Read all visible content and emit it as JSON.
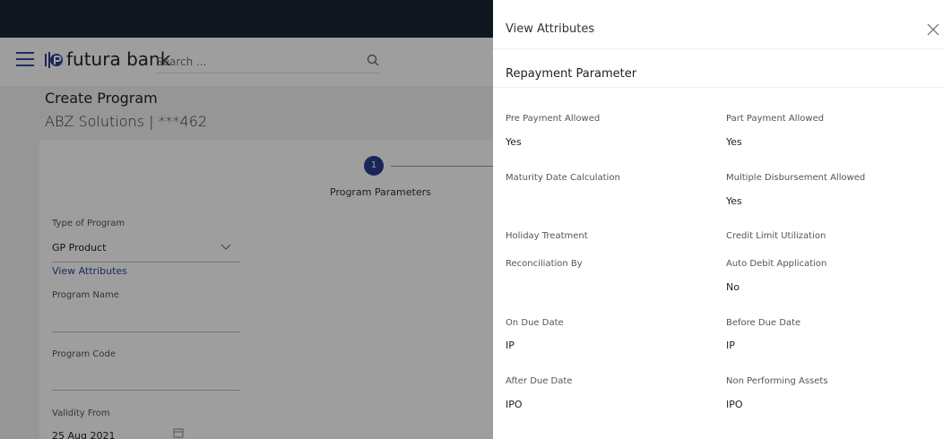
{
  "header": {
    "brand": "futura bank",
    "search_placeholder": "Search ..."
  },
  "page": {
    "title": "Create Program",
    "subtitle": "ABZ Solutions | ***462"
  },
  "stepper": {
    "step_number": "1",
    "step_label": "Program Parameters"
  },
  "form": {
    "type_label": "Type of Program",
    "type_value": "GP Product",
    "view_attributes_link": "View Attributes",
    "program_name_label": "Program Name",
    "program_code_label": "Program Code",
    "validity_from_label": "Validity From",
    "validity_from_value": "25 Aug 2021"
  },
  "drawer": {
    "title": "View Attributes",
    "section": "Repayment Parameter",
    "attributes": [
      {
        "label": "Pre Payment Allowed",
        "value": "Yes"
      },
      {
        "label": "Part Payment Allowed",
        "value": "Yes"
      },
      {
        "label": "Maturity Date Calculation",
        "value": ""
      },
      {
        "label": "Multiple Disbursement Allowed",
        "value": "Yes"
      },
      {
        "label": "Holiday Treatment",
        "value": ""
      },
      {
        "label": "Credit Limit Utilization",
        "value": ""
      },
      {
        "label": "Reconciliation By",
        "value": ""
      },
      {
        "label": "Auto Debit Application",
        "value": "No"
      },
      {
        "label": "On Due Date",
        "value": "IP"
      },
      {
        "label": "Before Due Date",
        "value": "IP"
      },
      {
        "label": "After Due Date",
        "value": "IPO"
      },
      {
        "label": "Non Performing Assets",
        "value": "IPO"
      }
    ]
  },
  "colors": {
    "topbar": "#1b2534",
    "accent": "#2c3e8f",
    "link": "#2c4a9a"
  }
}
